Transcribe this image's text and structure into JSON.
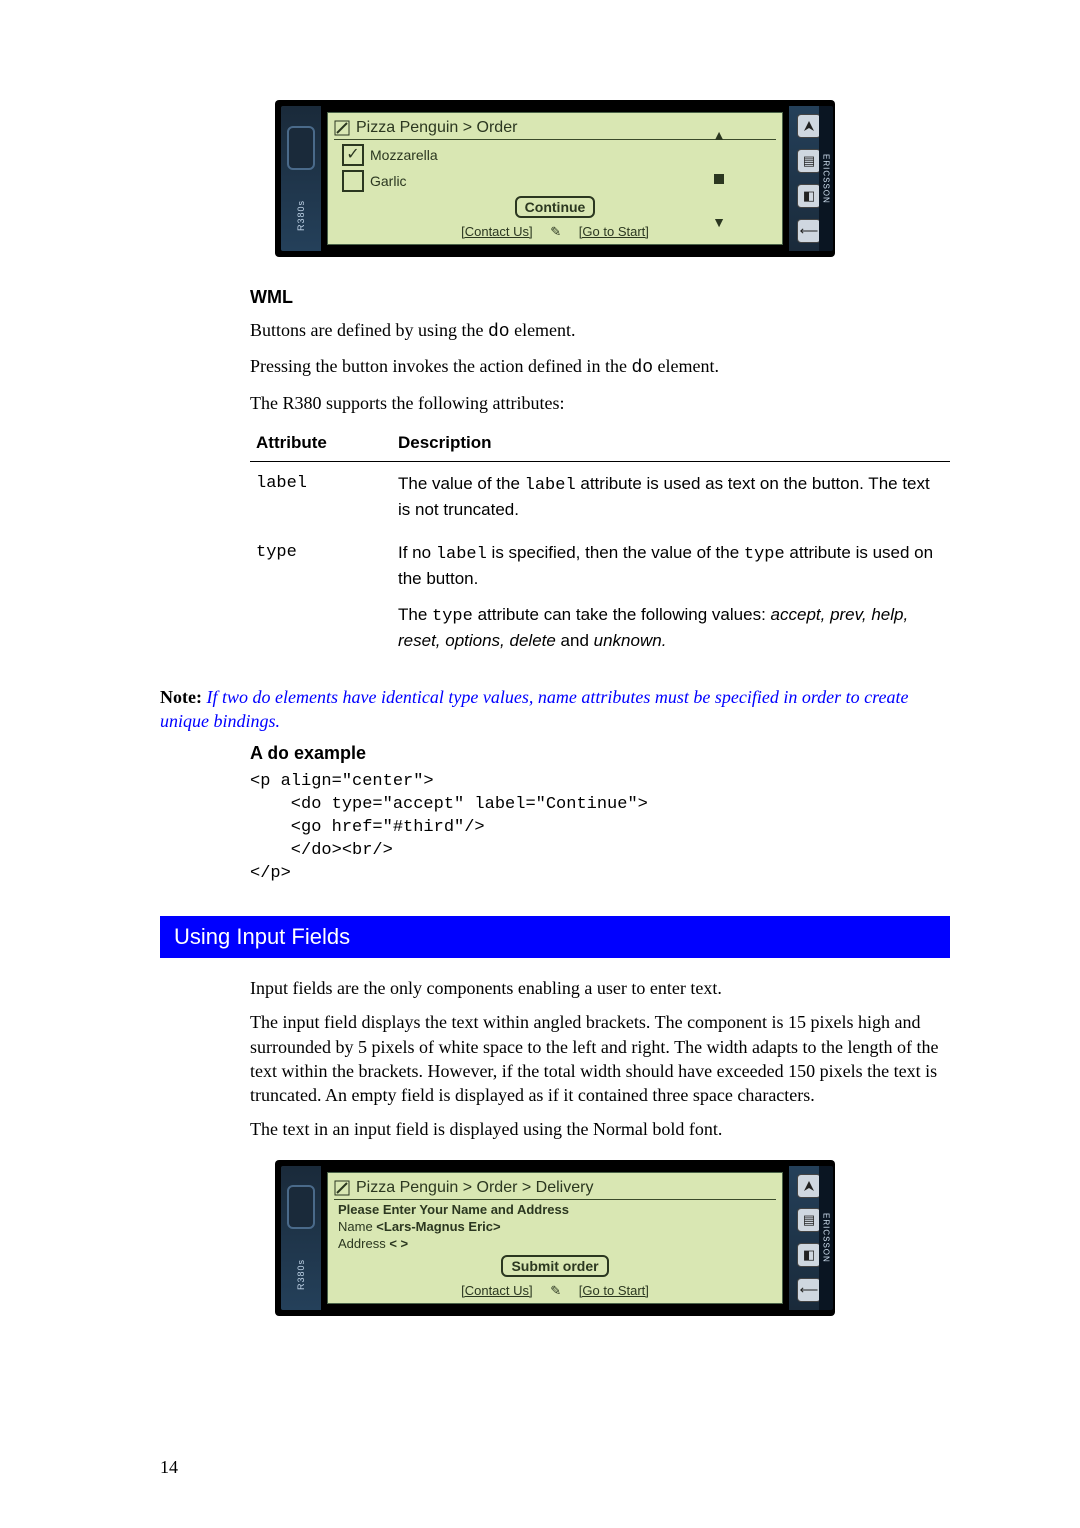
{
  "figure1": {
    "model_label": "R380s",
    "brand_label": "ERICSSON",
    "title": "Pizza Penguin > Order",
    "checkbox_items": [
      {
        "label": "Mozzarella",
        "checked": true
      },
      {
        "label": "Garlic",
        "checked": false
      }
    ],
    "button_label": "Continue",
    "link_left": "[Contact Us]",
    "link_right": "[Go to Start]"
  },
  "section_wml": {
    "heading": "WML",
    "para1_pre": "Buttons are defined by using the ",
    "para1_code": "do",
    "para1_post": " element.",
    "para2_pre": "Pressing the button invokes the action defined in the ",
    "para2_code": "do",
    "para2_post": " element.",
    "para3": "The R380 supports the following attributes:"
  },
  "attr_table": {
    "head_attr": "Attribute",
    "head_desc": "Description",
    "rows": {
      "r1": {
        "attr": "label",
        "desc_pre": "The value of the ",
        "desc_code": "label",
        "desc_post": " attribute is used as text on the button.  The text is not truncated."
      },
      "r2": {
        "attr": "type",
        "desc1_pre": "If no ",
        "desc1_code1": "label",
        "desc1_mid": " is specified, then the value of the ",
        "desc1_code2": "type",
        "desc1_post": " attribute is used on the button.",
        "desc2_pre": "The ",
        "desc2_code": "type",
        "desc2_mid": " attribute can take the following values: ",
        "desc2_italic1": "accept, prev, help, reset, options, delete",
        "desc2_and": " and ",
        "desc2_italic2": "unknown."
      }
    }
  },
  "note": {
    "label": "Note:",
    "text": "  If two do elements have identical type values, name attributes must be specified in order to create unique bindings."
  },
  "example": {
    "head_pre": "A ",
    "head_code": "do",
    "head_post": " example",
    "code": "<p align=\"center\">\n    <do type=\"accept\" label=\"Continue\">\n    <go href=\"#third\"/>\n    </do><br/>\n</p>"
  },
  "section_input": {
    "bar_title": "Using Input Fields",
    "para1": "Input fields are the only components enabling a user to enter text.",
    "para2": "The input field displays the text within angled brackets.  The component is 15 pixels high and surrounded by 5 pixels of white space to the left and right.  The width adapts to the length of the text within the brackets.  However, if the total width should have exceeded 150 pixels the text is truncated.  An empty field is displayed as if it contained three space characters.",
    "para3": "The text in an input field is displayed using the Normal bold font."
  },
  "figure2": {
    "model_label": "R380s",
    "brand_label": "ERICSSON",
    "title": "Pizza Penguin > Order > Delivery",
    "prompt": "Please Enter Your Name and Address",
    "name_label": "Name ",
    "name_value": "<Lars-Magnus Eric>",
    "addr_label": "Address ",
    "addr_value": "<   >",
    "button_label": "Submit order",
    "link_left": "[Contact Us]",
    "link_right": "[Go to Start]"
  },
  "page_number": "14"
}
